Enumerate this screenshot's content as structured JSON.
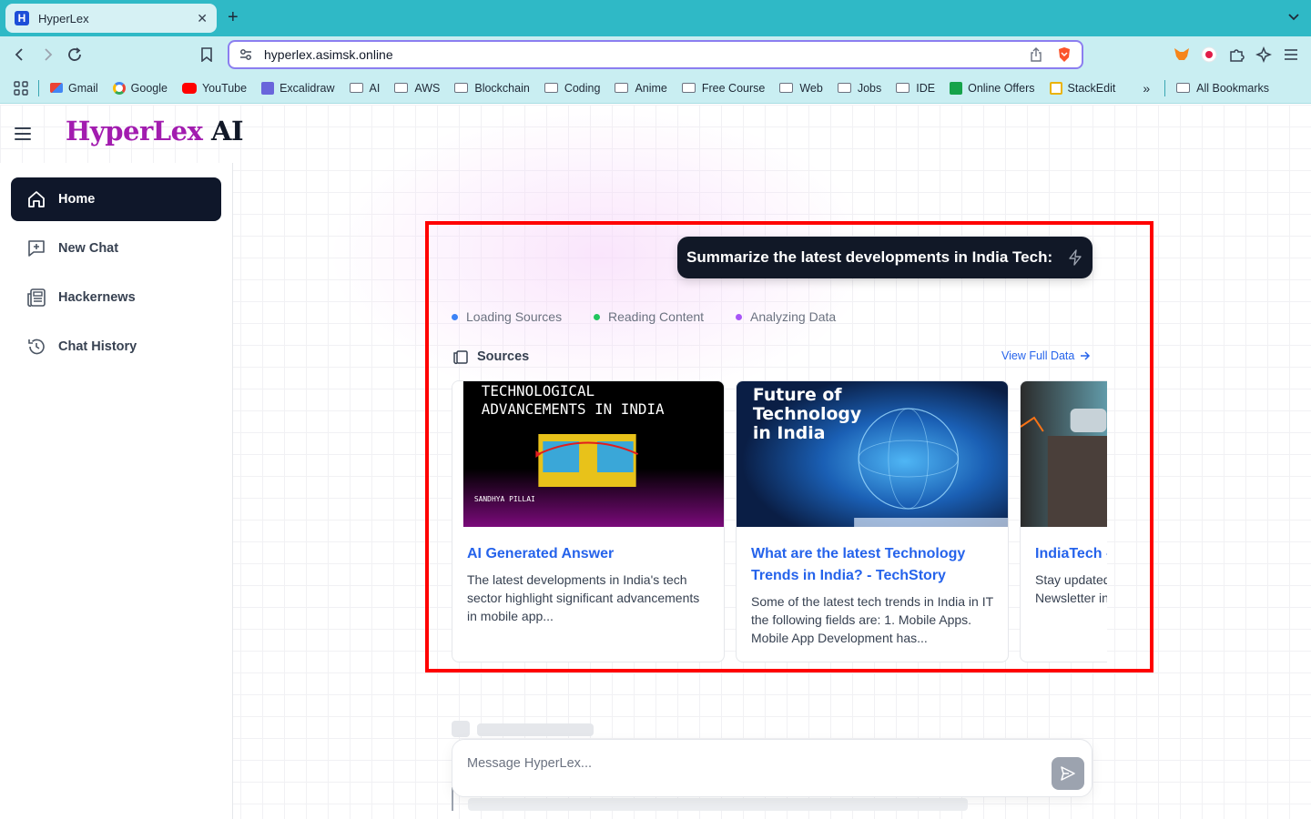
{
  "browser": {
    "tab_title": "HyperLex",
    "tab_favicon": "H",
    "url": "hyperlex.asimsk.online",
    "bookmarks": [
      {
        "label": "Gmail",
        "icon": "gmail-icon"
      },
      {
        "label": "Google",
        "icon": "google-icon"
      },
      {
        "label": "YouTube",
        "icon": "youtube-icon"
      },
      {
        "label": "Excalidraw",
        "icon": "excalidraw-icon"
      },
      {
        "label": "AI",
        "icon": "folder-icon"
      },
      {
        "label": "AWS",
        "icon": "folder-icon"
      },
      {
        "label": "Blockchain",
        "icon": "folder-icon"
      },
      {
        "label": "Coding",
        "icon": "folder-icon"
      },
      {
        "label": "Anime",
        "icon": "folder-icon"
      },
      {
        "label": "Free Course",
        "icon": "folder-icon"
      },
      {
        "label": "Web",
        "icon": "folder-icon"
      },
      {
        "label": "Jobs",
        "icon": "folder-icon"
      },
      {
        "label": "IDE",
        "icon": "folder-icon"
      },
      {
        "label": "Online Offers",
        "icon": "offers-icon"
      },
      {
        "label": "StackEdit",
        "icon": "stackedit-icon"
      }
    ],
    "all_bookmarks": "All Bookmarks",
    "accent": "#2fb9c6"
  },
  "app": {
    "brand_part1": "HyperLex",
    "brand_part2": "AI",
    "sidebar": [
      {
        "label": "Home",
        "icon": "home-icon",
        "active": true
      },
      {
        "label": "New Chat",
        "icon": "new-chat-icon",
        "active": false
      },
      {
        "label": "Hackernews",
        "icon": "newspaper-icon",
        "active": false
      },
      {
        "label": "Chat History",
        "icon": "history-icon",
        "active": false
      }
    ],
    "query": "Summarize the latest developments in India Tech:",
    "statuses": [
      {
        "label": "Loading Sources",
        "color": "#3b82f6"
      },
      {
        "label": "Reading Content",
        "color": "#22c55e"
      },
      {
        "label": "Analyzing Data",
        "color": "#a855f7"
      }
    ],
    "sources_label": "Sources",
    "view_full": "View Full Data",
    "cards": [
      {
        "title": "AI Generated Answer",
        "desc": "The latest developments in India's tech sector highlight significant advancements in mobile app...",
        "image_text": [
          "TECHNOLOGICAL",
          "ADVANCEMENTS IN INDIA"
        ],
        "image_caption": "SANDHYA  PILLAI"
      },
      {
        "title": "What are the latest Technology Trends in India? - TechStory",
        "desc": "Some of the latest tech trends in India in IT the following fields are: 1. Mobile Apps. Mobile App Development has...",
        "image_text": [
          "Future of",
          "Technology",
          "in India"
        ]
      },
      {
        "title": "IndiaTech - IndiaTech",
        "desc": "Stay updated with the IndiaTech Newsletter in startup news"
      }
    ],
    "message_placeholder": "Message HyperLex..."
  }
}
